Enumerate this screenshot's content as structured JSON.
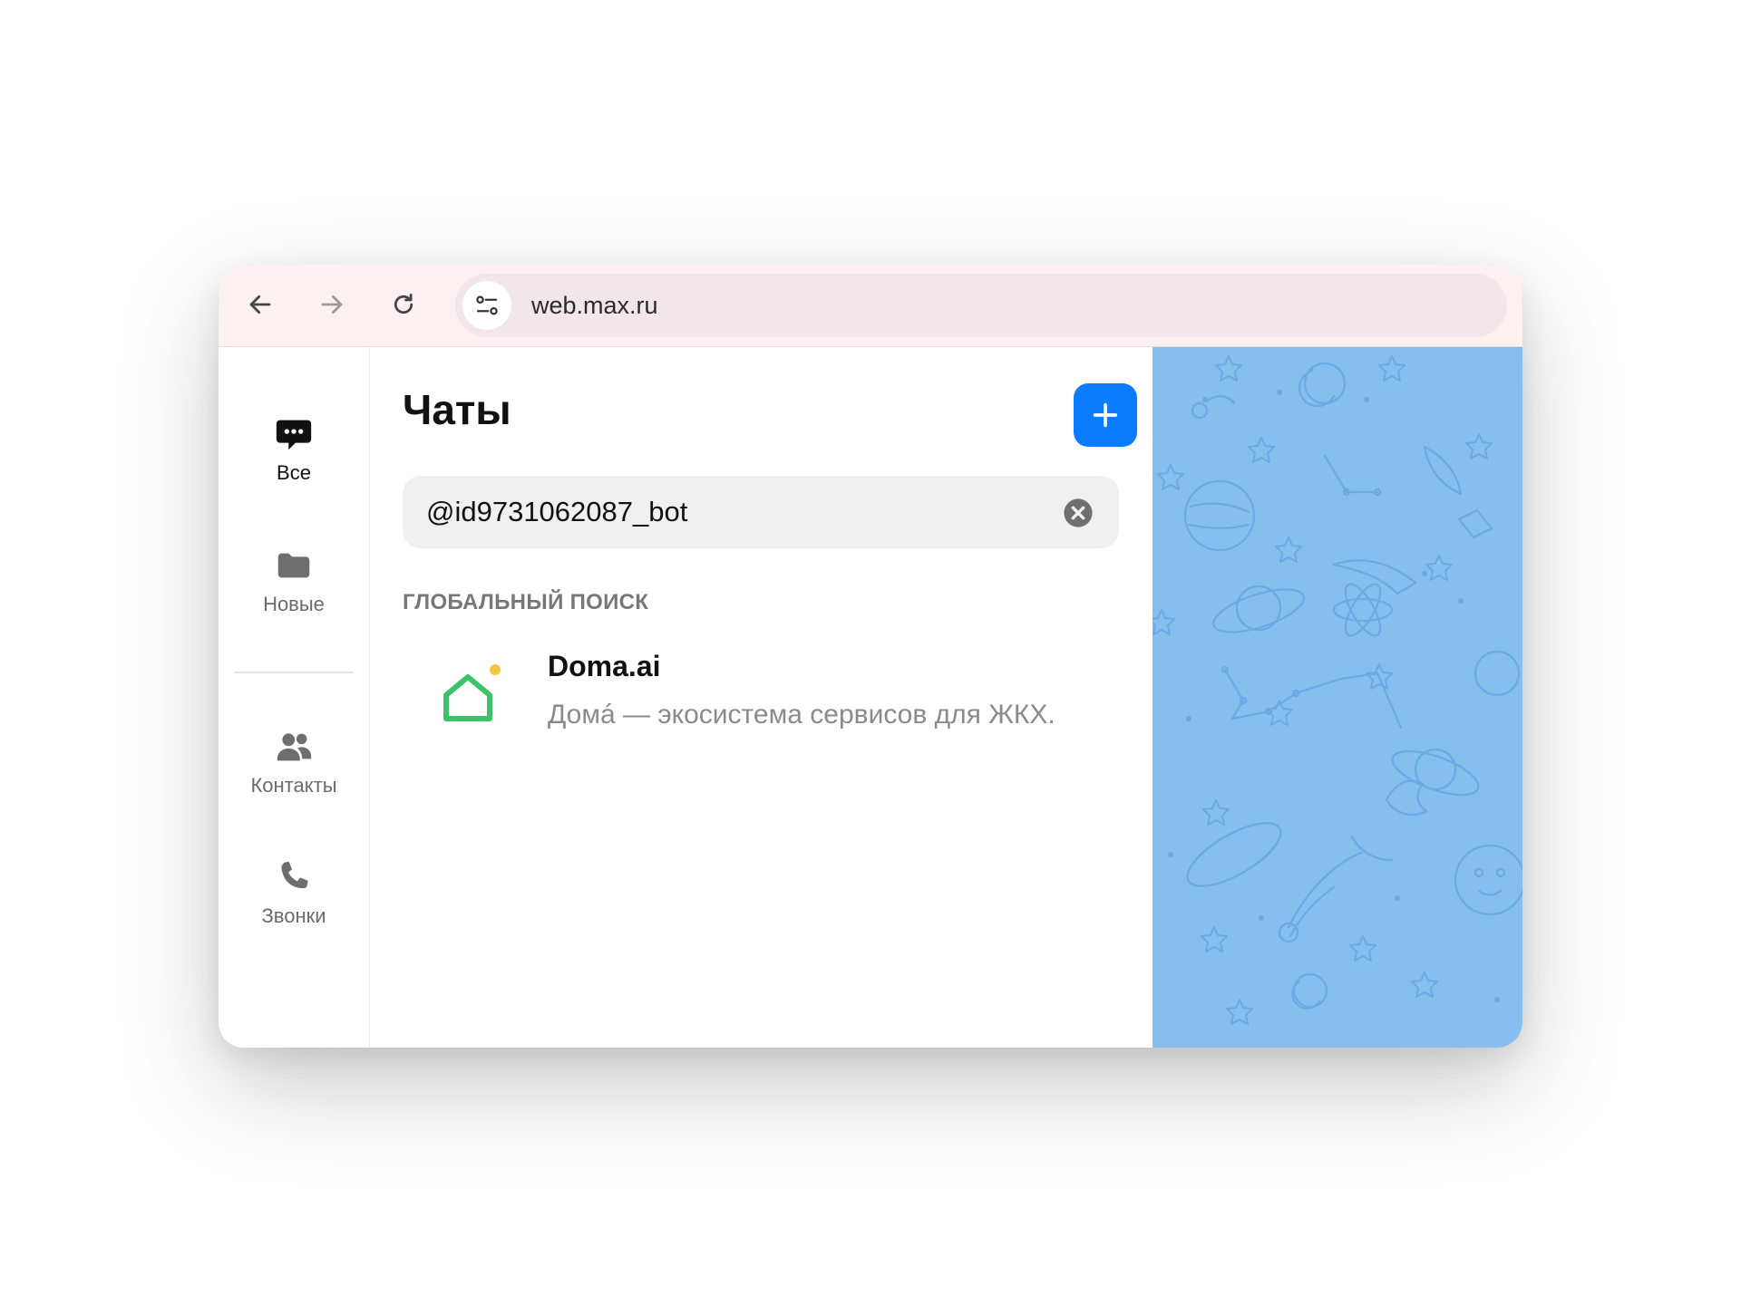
{
  "browser": {
    "url": "web.max.ru",
    "icons": {
      "back": "arrow-left-icon",
      "forward": "arrow-right-icon",
      "reload": "reload-icon",
      "site_info": "tune-icon"
    }
  },
  "sidebar": {
    "items": [
      {
        "label": "Все",
        "icon": "chat-bubble-icon",
        "active": true
      },
      {
        "label": "Новые",
        "icon": "folder-icon",
        "active": false
      },
      {
        "label": "Контакты",
        "icon": "people-icon",
        "active": false
      },
      {
        "label": "Звонки",
        "icon": "phone-icon",
        "active": false
      }
    ]
  },
  "main": {
    "title": "Чаты",
    "new_chat_icon": "plus-icon",
    "search": {
      "value": "@id9731062087_bot",
      "clear_icon": "close-circle-icon"
    },
    "section_title": "ГЛОБАЛЬНЫЙ ПОИСК",
    "results": [
      {
        "name": "Doma.ai",
        "description": "Домá — экосистема сервисов для ЖКХ.",
        "avatar_icon": "house-icon"
      }
    ]
  },
  "colors": {
    "accent": "#0a7cff",
    "chat_background": "#86bfee",
    "house_green": "#3cc36a",
    "house_dot": "#f5c542"
  }
}
